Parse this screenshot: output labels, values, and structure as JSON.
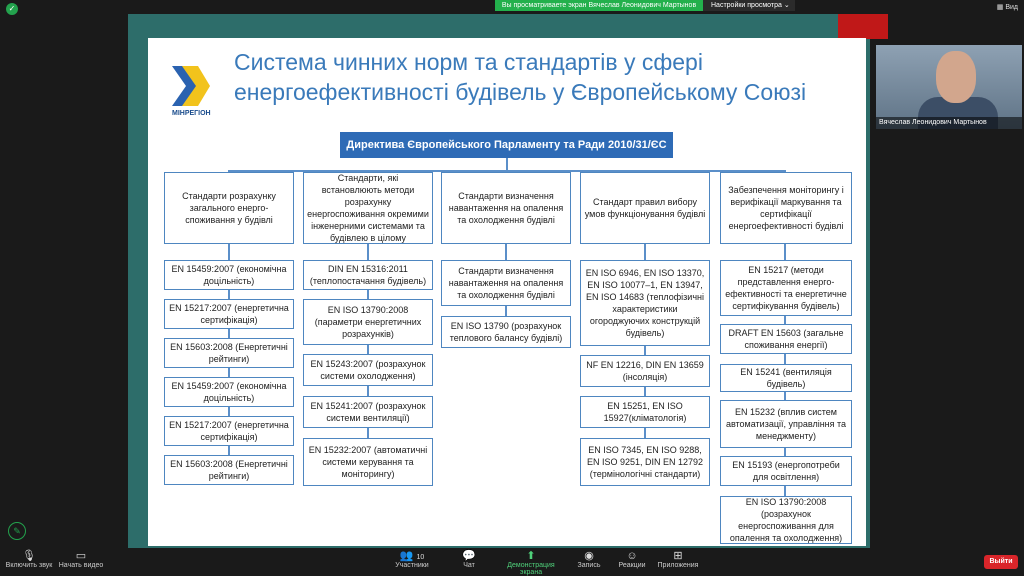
{
  "share_bar": {
    "notice": "Вы просматриваете экран Вячеслав Леонидович Мартынов",
    "options": "Настройки просмотра",
    "view": "Вид"
  },
  "slide": {
    "title_line1": "Система чинних норм та стандартів у сфері",
    "title_line2": "енергоефективності будівель у Європейському Союзі",
    "logo_text": "МІНРЕГІОН",
    "directive": "Директива Європейського Парламенту та Ради 2010/31/ЄС",
    "col1": {
      "head": "Стандарти розрахунку загального енерго-споживання у будівлі",
      "items": [
        "EN 15459:2007 (економічна доцільність)",
        "EN 15217:2007 (енергетична сертифікація)",
        "EN 15603:2008 (Енергетичні рейтинги)",
        "EN 15459:2007 (економічна доцільність)",
        "EN 15217:2007 (енергетична сертифікація)",
        "EN 15603:2008 (Енергетичні рейтинги)"
      ]
    },
    "col2": {
      "head": "Стандарти, які встановлюють методи розрахунку енергоспоживання окремими інженерними системами та будівлею в цілому",
      "items": [
        "DIN EN 15316:2011 (теплопостачання будівель)",
        "EN ISO 13790:2008 (параметри енергетичних розрахунків)",
        "EN 15243:2007 (розрахунок системи охолодження)",
        "EN 15241:2007 (розрахунок системи вентиляції)",
        "EN 15232:2007 (автоматичні системи керування та моніторингу)"
      ]
    },
    "col3": {
      "head": "Стандарти визначення навантаження на опалення та охолодження будівлі",
      "items": [
        "Стандарти визначення навантаження на опалення та охолодження будівлі",
        "EN ISO 13790 (розрахунок теплового балансу будівлі)"
      ]
    },
    "col4": {
      "head": "Стандарт правил вибору умов функціонування будівлі",
      "items": [
        "EN ISO 6946, EN ISO 13370, EN ISO 10077–1, EN 13947, EN ISO 14683 (теплофізичні характеристики огороджуючих конструкцій будівель)",
        "NF EN 12216, DIN EN 13659 (інсоляція)",
        "EN 15251, EN ISO 15927(кліматологія)",
        "EN ISO 7345, EN ISO 9288, EN ISO 9251, DIN EN 12792 (термінологічні стандарти)"
      ]
    },
    "col5": {
      "head": "Забезпечення моніторингу і верифікації маркування та сертифікації енергоефективності будівлі",
      "items": [
        "EN 15217 (методи представлення енерго-ефективності та енергетичне сертифікування будівель)",
        "DRAFT EN 15603 (загальне споживання енергії)",
        "EN 15241 (вентиляція будівель)",
        "EN 15232 (вплив систем автоматизації, управління та менеджменту)",
        "EN 15193 (енергопотреби для освітлення)",
        "EN ISO 13790:2008 (розрахунок енергоспоживання для опалення та охолодження)"
      ]
    }
  },
  "participant": {
    "name": "Вячеслав Леонидович Мартынов"
  },
  "toolbar": {
    "audio": "Включить звук",
    "video": "Начать видео",
    "participants": "Участники",
    "participants_count": "10",
    "chat": "Чат",
    "share": "Демонстрация экрана",
    "record": "Запись",
    "reactions": "Реакции",
    "apps": "Приложения",
    "leave": "Выйти"
  },
  "colors": {
    "accent": "#2e6bb6",
    "share_green": "#23b04c",
    "leave_red": "#d9252a"
  }
}
